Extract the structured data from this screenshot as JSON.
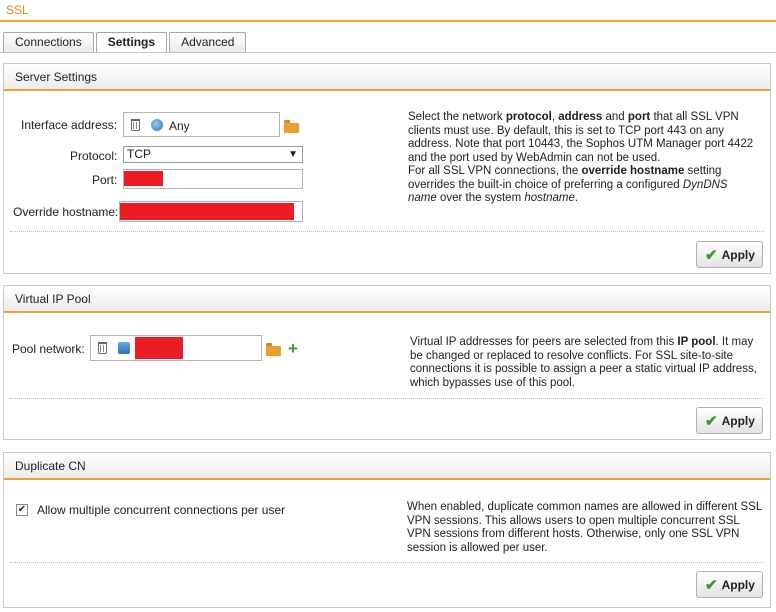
{
  "page": {
    "title": "SSL"
  },
  "tabs": [
    {
      "label": "Connections",
      "active": false
    },
    {
      "label": "Settings",
      "active": true
    },
    {
      "label": "Advanced",
      "active": false
    }
  ],
  "server_settings": {
    "title": "Server Settings",
    "interface_label": "Interface address:",
    "interface_value": "Any",
    "protocol_label": "Protocol:",
    "protocol_value": "TCP",
    "port_label": "Port:",
    "override_label": "Override hostname:",
    "help_html": "Select the network <b>protocol</b>, <b>address</b> and <b>port</b> that all SSL VPN clients must use. By default, this is set to TCP port 443 on any address. Note that port 10443, the Sophos UTM Manager port 4422 and the port used by WebAdmin can not be used.<br>For all SSL VPN connections, the <b>override hostname</b> setting overrides the built-in choice of preferring a configured <i>DynDNS name</i> over the system <i>hostname</i>.",
    "apply_label": "Apply"
  },
  "virtual_ip_pool": {
    "title": "Virtual IP Pool",
    "pool_label": "Pool network:",
    "help_html": "Virtual IP addresses for peers are selected from this <b>IP pool</b>. It may be changed or replaced to resolve conflicts. For SSL site-to-site connections it is possible to assign a peer a static virtual IP address, which bypasses use of this pool.",
    "apply_label": "Apply"
  },
  "duplicate_cn": {
    "title": "Duplicate CN",
    "checkbox_label": "Allow multiple concurrent connections per user",
    "checkbox_checked": true,
    "help": "When enabled, duplicate common names are allowed in different SSL VPN sessions. This allows users to open multiple concurrent SSL VPN sessions from different hosts. Otherwise, only one SSL VPN session is allowed per user.",
    "apply_label": "Apply"
  },
  "colors": {
    "accent": "#f0a030",
    "title": "#e8830c",
    "redaction": "#ec1c24",
    "apply_check": "#3a9a2a"
  },
  "icons": [
    "trash-icon",
    "globe-icon",
    "folder-icon",
    "network-icon",
    "plus-icon",
    "check-icon"
  ]
}
